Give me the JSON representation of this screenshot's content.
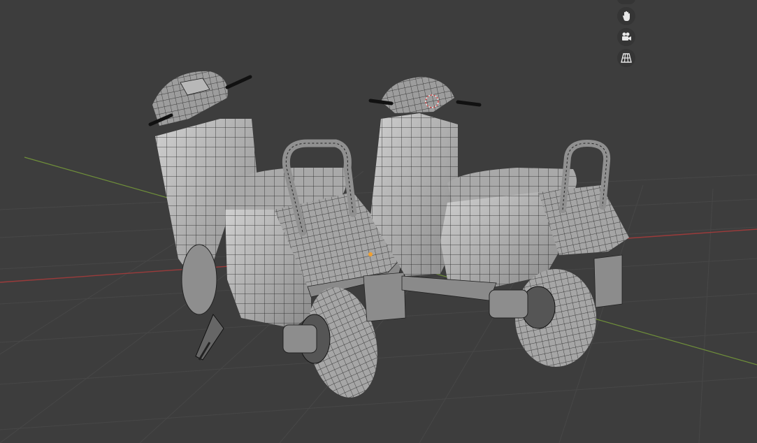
{
  "viewport": {
    "background": "#3d3d3d",
    "grid_color": "#4a4a4a",
    "x_axis_color": "#9b3b3b",
    "y_axis_color": "#6f8f3a",
    "model_color": "#b5b5b5",
    "wire_color": "#1e1e1e",
    "origin_color": "#f0a030",
    "cursor_color": "#d94a4a"
  },
  "navigation_gizmo": {
    "buttons": [
      {
        "name": "orbit-gizmo-partial",
        "icon": "orbit-icon"
      },
      {
        "name": "pan-view-button",
        "icon": "hand-icon"
      },
      {
        "name": "camera-view-button",
        "icon": "camera-icon"
      },
      {
        "name": "perspective-toggle-button",
        "icon": "grid-icon"
      }
    ]
  },
  "scene": {
    "objects": [
      "scooter-left",
      "scooter-right"
    ]
  }
}
